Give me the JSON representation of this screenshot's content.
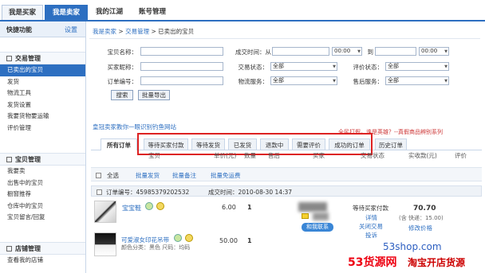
{
  "top_tabs": [
    "我是买家",
    "我是卖家",
    "我的江湖",
    "账号管理"
  ],
  "sidebar": {
    "quick_title": "快捷功能",
    "quick_setting": "设置",
    "sections": [
      {
        "title": "交易管理",
        "items": [
          "已卖出的宝贝",
          "发货",
          "物流工具",
          "发货设置",
          "我要货物要运输",
          "评价管理"
        ]
      },
      {
        "title": "宝贝管理",
        "items": [
          "我要卖",
          "出售中的宝贝",
          "橱窗推荐",
          "仓库中的宝贝",
          "宝贝留言/回复"
        ]
      },
      {
        "title": "店铺管理",
        "items": [
          "查看我的店铺"
        ]
      }
    ]
  },
  "breadcrumb": {
    "a": "我是卖家",
    "b": "交易管理",
    "c": "已卖出的宝贝"
  },
  "filters": {
    "item_name": "宝贝名称：",
    "trade_time": "成交时间：从",
    "time_from": "00:00",
    "to": "到",
    "time_to": "00:00",
    "buyer": "买家昵称：",
    "trade_status": "交易状态：",
    "trade_status_val": "全部",
    "rate_status": "评价状态：",
    "rate_status_val": "全部",
    "order_no": "订单编号：",
    "logistics": "物流服务：",
    "logistics_val": "全部",
    "aftersale": "售后服务：",
    "aftersale_val": "全部",
    "search_btn": "搜索",
    "export_btn": "批量导出"
  },
  "promo_left": "皇冠卖家教你一眼识别钓鱼网站",
  "promo_right": "全民打假，谁是英雄？--真假商品辨别系列",
  "order_tabs": [
    "所有订单",
    "等待买家付款",
    "等待发货",
    "已发货",
    "退款中",
    "需要评价",
    "成功的订单",
    "历史订单"
  ],
  "columns": [
    "宝贝",
    "单价(元)",
    "数量",
    "售后",
    "买家",
    "交易状态",
    "实收款(元)",
    "评价"
  ],
  "bulk": {
    "select_all": "全选",
    "batch_ship": "批量发货",
    "batch_note": "批量备注",
    "batch_free": "批量免运费"
  },
  "order": {
    "order_no_label": "订单编号：45985379202532",
    "time_label": "成交时间：2010-08-30 14:37",
    "item1_name": "宝宝鞋",
    "item1_price": "6.00",
    "item1_qty": "1",
    "item2_name": "可爱淑女印花吊带",
    "item2_attr": "颜色分类：黑色   尺码：均码",
    "item2_price": "50.00",
    "item2_qty": "1",
    "status": "等待买家付款",
    "detail": "详情",
    "close": "关闭交易",
    "complain": "投诉",
    "total": "70.70",
    "shipping": "(含 快递：15.00)",
    "modify": "修改价格",
    "contact": "和我联系"
  },
  "watermark": {
    "site": "53shop.com",
    "brand": "53货源网",
    "slogan": "淘宝开店货源"
  }
}
